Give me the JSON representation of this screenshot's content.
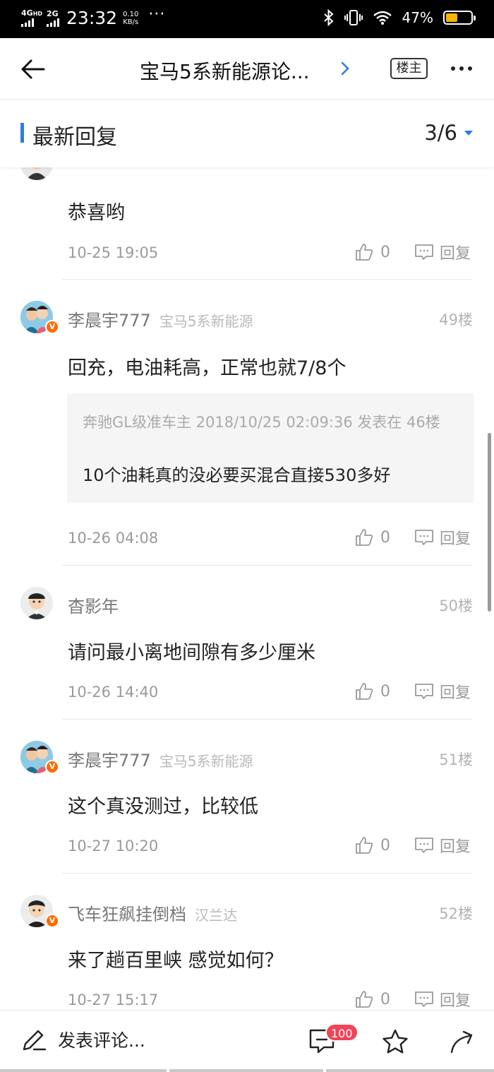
{
  "status_bar": {
    "net1": "4G",
    "net1_suffix": "HD",
    "net2": "2G",
    "time": "23:32",
    "speed_value": "0.10",
    "speed_unit": "KB/s",
    "dots": "···",
    "battery_pct": "47%",
    "battery_level": 0.47,
    "battery_color": "#f5b400"
  },
  "nav": {
    "title": "宝马5系新能源论...",
    "owner_badge": "楼主"
  },
  "section": {
    "title": "最新回复",
    "page_indicator": "3/6",
    "accent_color": "#2d7ce3"
  },
  "posts": [
    {
      "content": "恭喜哟",
      "time": "10-25 19:05",
      "likes": "0",
      "reply_label": "回复"
    },
    {
      "user": "李晨宇777",
      "tag": "宝马5系新能源",
      "floor": "49楼",
      "content": "回充，电油耗高，正常也就7/8个",
      "quote_meta": "奔驰GL级准车主 2018/10/25 02:09:36 发表在 46楼",
      "quote_text": "10个油耗真的没必要买混合直接530多好",
      "time": "10-26 04:08",
      "likes": "0",
      "reply_label": "回复"
    },
    {
      "user": "杳影年",
      "tag": "",
      "floor": "50楼",
      "content": "请问最小离地间隙有多少厘米",
      "time": "10-26 14:40",
      "likes": "0",
      "reply_label": "回复"
    },
    {
      "user": "李晨宇777",
      "tag": "宝马5系新能源",
      "floor": "51楼",
      "content": "这个真没测过，比较低",
      "time": "10-27 10:20",
      "likes": "0",
      "reply_label": "回复"
    },
    {
      "user": "飞车狂飙挂倒档",
      "tag": "汉兰达",
      "floor": "52楼",
      "content": "来了趟百里峡 感觉如何？",
      "time": "10-27 15:17",
      "likes": "0",
      "reply_label": "回复"
    }
  ],
  "bottom_bar": {
    "compose_label": "发表评论...",
    "comment_count": "100",
    "badge_color": "#f0445a"
  }
}
